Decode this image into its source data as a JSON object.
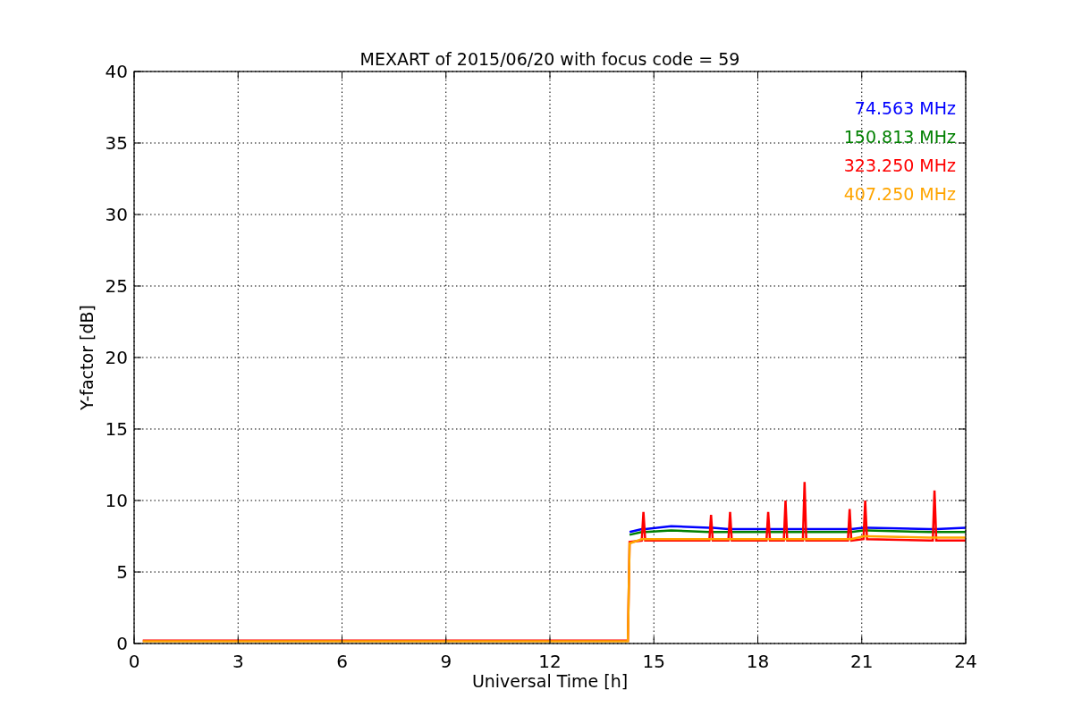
{
  "chart_data": {
    "type": "line",
    "title": "MEXART of 2015/06/20 with focus code = 59",
    "xlabel": "Universal Time [h]",
    "ylabel": "Y-factor [dB]",
    "x": [
      0.25,
      1.2,
      12.0,
      14.25,
      14.3,
      14.65,
      14.7,
      14.75,
      15.5,
      16.6,
      16.65,
      16.7,
      17.15,
      17.2,
      17.25,
      18.25,
      18.3,
      18.35,
      18.75,
      18.8,
      18.85,
      19.3,
      19.35,
      19.4,
      20.6,
      20.65,
      20.7,
      21.05,
      21.1,
      21.15,
      22.95,
      23.05,
      23.1,
      23.15,
      24.0
    ],
    "series": [
      {
        "name": "74.563 MHz",
        "color": "#0000ff",
        "values": [
          null,
          null,
          null,
          null,
          7.8,
          8.0,
          8.0,
          8.0,
          8.2,
          8.1,
          8.1,
          8.1,
          8.0,
          8.0,
          8.0,
          8.0,
          8.0,
          8.0,
          8.0,
          8.0,
          8.0,
          8.0,
          8.0,
          8.0,
          8.0,
          8.0,
          8.0,
          8.1,
          8.1,
          8.1,
          8.0,
          8.0,
          8.0,
          8.0,
          8.1
        ]
      },
      {
        "name": "150.813 MHz",
        "color": "#008000",
        "values": [
          null,
          null,
          null,
          null,
          7.6,
          7.8,
          7.8,
          7.8,
          7.9,
          7.8,
          7.8,
          7.8,
          7.8,
          7.8,
          7.8,
          7.8,
          7.8,
          7.8,
          7.8,
          7.8,
          7.8,
          7.8,
          7.8,
          7.8,
          7.8,
          7.8,
          7.8,
          7.9,
          7.9,
          7.9,
          7.8,
          7.8,
          7.8,
          7.8,
          7.8
        ]
      },
      {
        "name": "323.250 MHz",
        "color": "#ff0000",
        "values": [
          0.2,
          0.2,
          0.2,
          0.2,
          7.1,
          7.2,
          9.2,
          7.2,
          7.2,
          7.2,
          9.0,
          7.2,
          7.2,
          9.2,
          7.2,
          7.2,
          9.2,
          7.2,
          7.2,
          10.0,
          7.2,
          7.2,
          11.3,
          7.2,
          7.2,
          9.4,
          7.2,
          7.3,
          10.0,
          7.3,
          7.2,
          7.2,
          10.7,
          7.2,
          7.2
        ]
      },
      {
        "name": "407.250 MHz",
        "color": "#ffa500",
        "values": [
          0.15,
          0.15,
          0.15,
          0.15,
          7.0,
          7.3,
          7.3,
          7.3,
          7.3,
          7.3,
          7.3,
          7.3,
          7.3,
          7.3,
          7.3,
          7.3,
          7.3,
          7.3,
          7.3,
          7.3,
          7.3,
          7.3,
          7.3,
          7.3,
          7.3,
          7.3,
          7.3,
          7.5,
          7.5,
          7.5,
          7.4,
          7.4,
          7.4,
          7.4,
          7.4
        ]
      }
    ],
    "grid": true,
    "xlim": [
      0,
      24
    ],
    "ylim": [
      0,
      40
    ],
    "xticks": [
      0,
      3,
      6,
      9,
      12,
      15,
      18,
      21,
      24
    ],
    "yticks": [
      0,
      5,
      10,
      15,
      20,
      25,
      30,
      35,
      40
    ]
  }
}
